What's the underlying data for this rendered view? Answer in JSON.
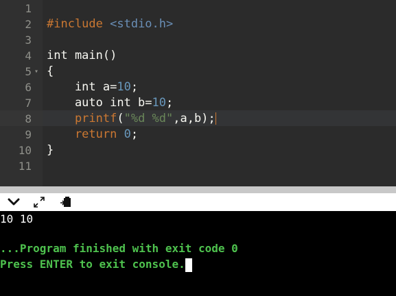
{
  "editor": {
    "line_numbers": [
      "1",
      "2",
      "3",
      "4",
      "5",
      "6",
      "7",
      "8",
      "9",
      "10",
      "11"
    ],
    "fold_marker": "▾",
    "lines": {
      "l2": {
        "pre": "#include",
        "inc": " <stdio.h>"
      },
      "l4": {
        "text": "int main()"
      },
      "l5": {
        "text": "{"
      },
      "l6": {
        "kw": "    int a=",
        "num": "10",
        "end": ";"
      },
      "l7": {
        "kw": "    auto int b=",
        "num": "10",
        "end": ";"
      },
      "l8": {
        "fn": "    printf",
        "op1": "(",
        "str": "\"%d %d\"",
        "op2": ",a,b);"
      },
      "l9": {
        "kw": "    return ",
        "num": "0",
        "end": ";"
      },
      "l10": {
        "text": "}"
      }
    }
  },
  "toolbar": {
    "collapse_icon": "chevron-down-icon",
    "expand_icon": "expand-icon",
    "copy_icon": "clipboard-icon"
  },
  "console": {
    "output_line": "10 10",
    "finish_line": "...Program finished with exit code 0",
    "prompt_line": "Press ENTER to exit console."
  },
  "colors": {
    "editor_bg": "#2b2b2b",
    "preprocessor": "#cb7832",
    "include": "#6a8fb7",
    "number": "#6897bb",
    "string": "#6a8759",
    "console_green": "#4ec24e"
  }
}
